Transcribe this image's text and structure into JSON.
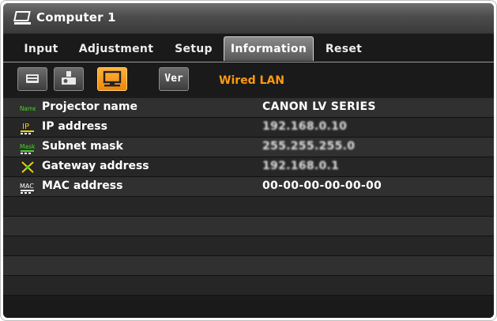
{
  "window": {
    "title": "Computer 1",
    "icon": "computer-monitor-icon"
  },
  "tabs": [
    {
      "label": "Input",
      "active": false
    },
    {
      "label": "Adjustment",
      "active": false
    },
    {
      "label": "Setup",
      "active": false
    },
    {
      "label": "Information",
      "active": true
    },
    {
      "label": "Reset",
      "active": false
    }
  ],
  "toolbar": {
    "buttons": [
      {
        "icon": "display-info-icon",
        "active": false
      },
      {
        "icon": "projector-lamp-icon",
        "active": false
      },
      {
        "icon": "network-lan-icon",
        "active": true
      },
      {
        "icon": "version-icon",
        "label": "Ver",
        "active": false
      }
    ],
    "section_label": "Wired LAN"
  },
  "rows": [
    {
      "icon": "name-icon",
      "icon_text": "Name",
      "label": "Projector name",
      "value": "CANON LV SERIES"
    },
    {
      "icon": "ip-icon",
      "icon_text": "IP",
      "label": "IP address",
      "value": "192.168.0.10"
    },
    {
      "icon": "mask-icon",
      "icon_text": "Mask",
      "label": "Subnet mask",
      "value": "255.255.255.0"
    },
    {
      "icon": "gateway-icon",
      "label": "Gateway address",
      "value": "192.168.0.1"
    },
    {
      "icon": "mac-icon",
      "icon_text": "MAC",
      "label": "MAC address",
      "value": "00-00-00-00-00-00"
    }
  ],
  "colors": {
    "accent": "#ff9a0e",
    "active_button": "#f7a12a",
    "icon_green": "#4fd12a",
    "icon_yellow": "#f0d000"
  }
}
